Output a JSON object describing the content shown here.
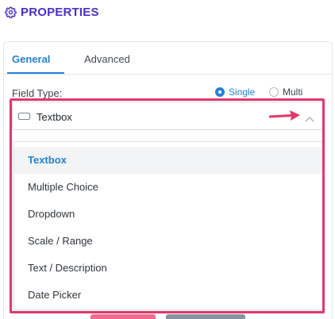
{
  "header": {
    "title": "PROPERTIES",
    "icon": "gear-icon"
  },
  "tabs": [
    {
      "label": "General",
      "active": true
    },
    {
      "label": "Advanced",
      "active": false
    }
  ],
  "field_type": {
    "label": "Field Type:",
    "options": [
      {
        "label": "Single",
        "checked": true
      },
      {
        "label": "Multi",
        "checked": false
      }
    ]
  },
  "select": {
    "value": "Textbox",
    "icon": "textbox-icon",
    "open": true
  },
  "dropdown": {
    "options": [
      {
        "label": "Textbox",
        "selected": true
      },
      {
        "label": "Multiple Choice",
        "selected": false
      },
      {
        "label": "Dropdown",
        "selected": false
      },
      {
        "label": "Scale / Range",
        "selected": false
      },
      {
        "label": "Text / Description",
        "selected": false
      },
      {
        "label": "Date Picker",
        "selected": false
      }
    ]
  },
  "colors": {
    "brand": "#4b2fc9",
    "accent": "#2481d6",
    "highlight": "#e0386b"
  }
}
